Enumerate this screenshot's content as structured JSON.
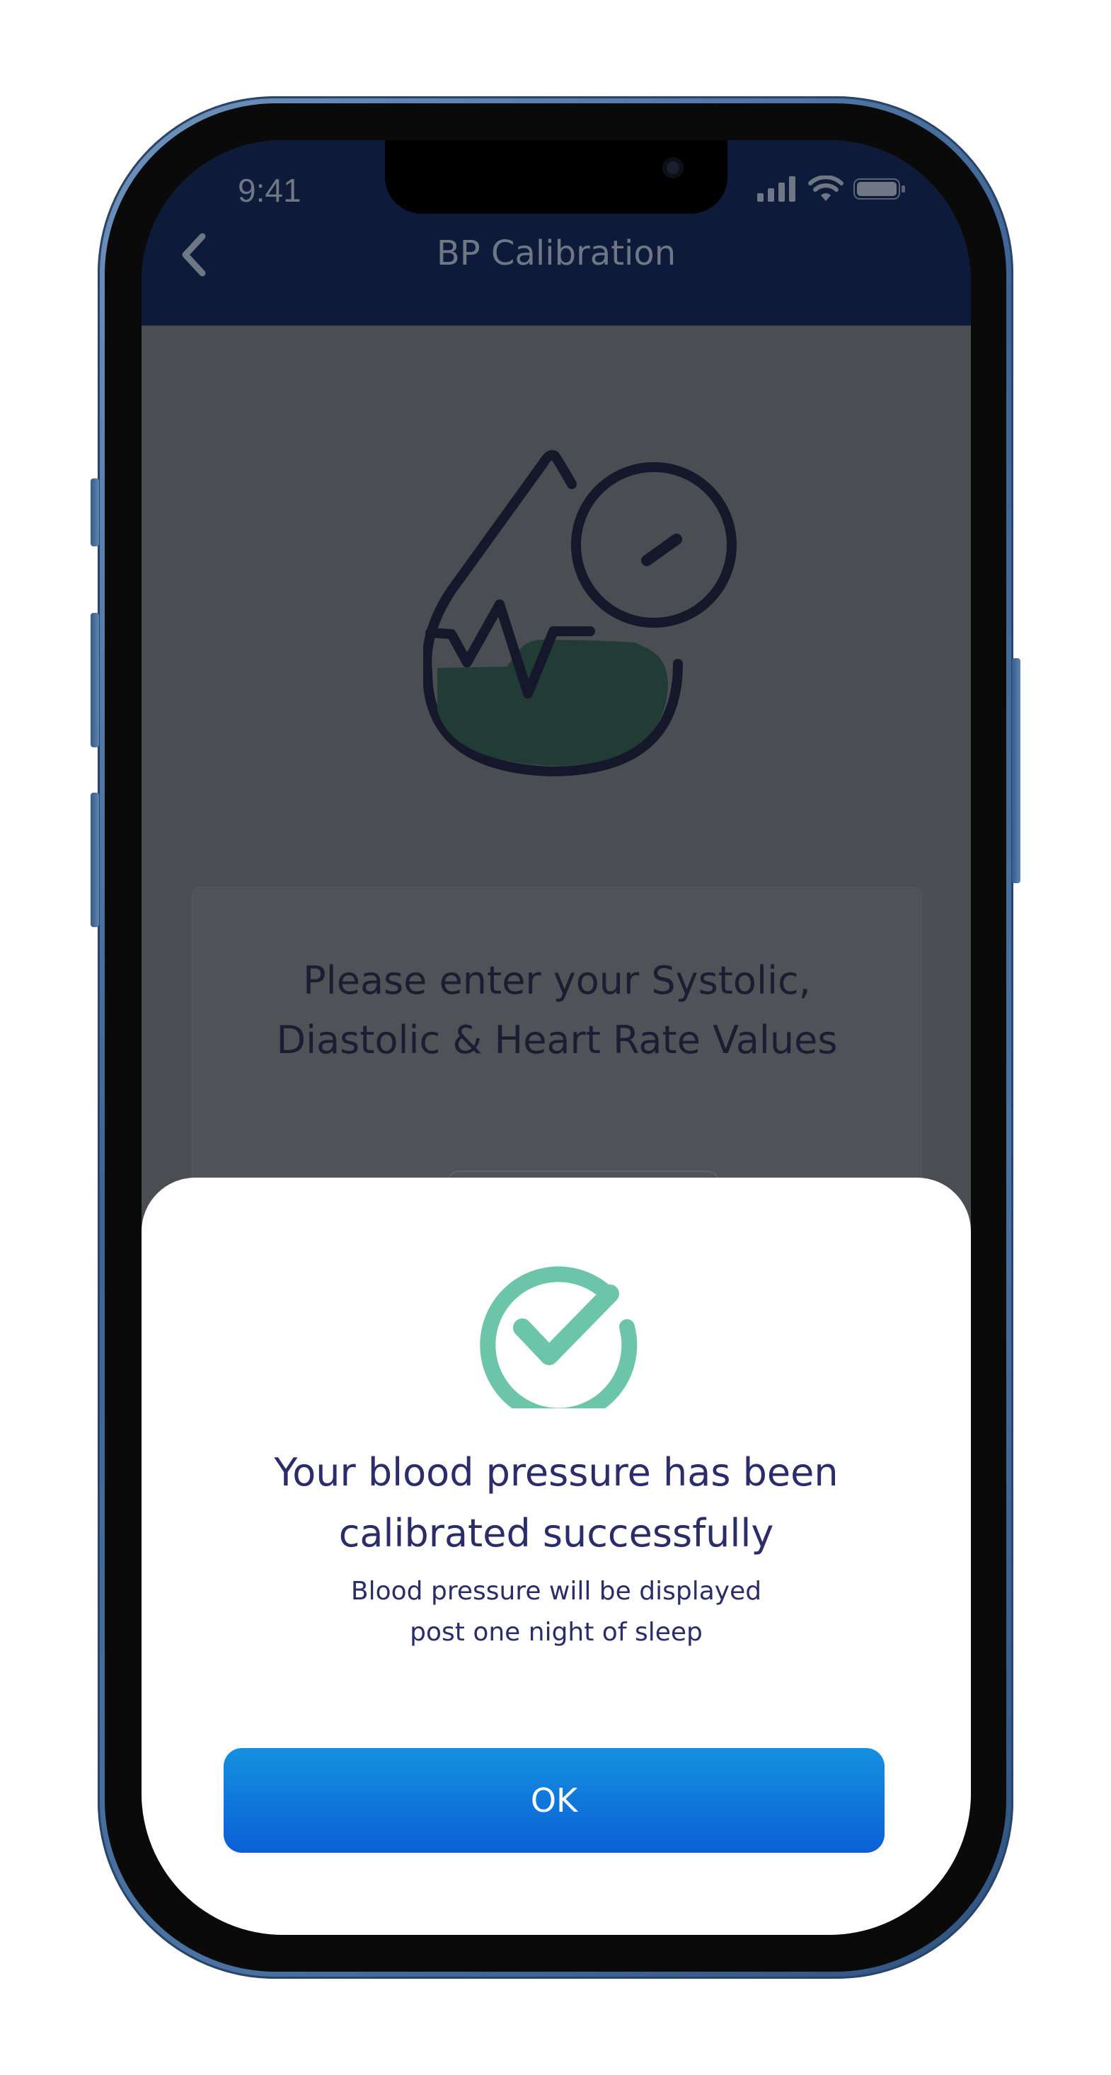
{
  "status_bar": {
    "time": "9:41"
  },
  "header": {
    "title": "BP Calibration",
    "back_icon": "chevron-left-icon"
  },
  "illustration": {
    "icon": "blood-drop-gauge-icon"
  },
  "card": {
    "title_line1": "Please enter your Systolic,",
    "title_line2": "Diastolic & Heart Rate Values"
  },
  "dialog": {
    "icon": "check-circle-icon",
    "title_line1": "Your blood pressure has been",
    "title_line2": "calibrated successfully",
    "subtitle_line1": "Blood pressure will be displayed",
    "subtitle_line2": "post one night of sleep",
    "ok_label": "OK"
  },
  "colors": {
    "accent_green": "#6cc5a8",
    "button_blue": "#0b5fd6",
    "title_navy": "#2b2d6b",
    "header_bg": "#0d1a3a"
  }
}
